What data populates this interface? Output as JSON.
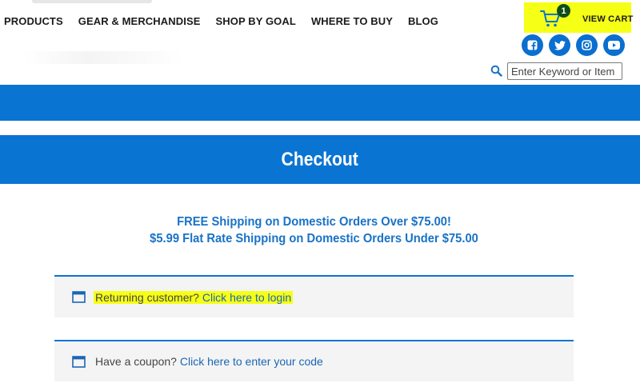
{
  "nav": {
    "items": [
      {
        "label": "PRODUCTS"
      },
      {
        "label": "GEAR & MERCHANDISE"
      },
      {
        "label": "SHOP BY GOAL"
      },
      {
        "label": "WHERE TO BUY"
      },
      {
        "label": "BLOG"
      }
    ]
  },
  "cart": {
    "count": "1",
    "label": "VIEW CART",
    "highlight_color": "#f6ff16"
  },
  "social": [
    "facebook-icon",
    "twitter-icon",
    "instagram-icon",
    "youtube-icon"
  ],
  "search": {
    "placeholder": "Enter Keyword or Item"
  },
  "page": {
    "title": "Checkout",
    "band_color": "#0a74d2"
  },
  "shipping": {
    "line1": "FREE Shipping on Domestic Orders Over $75.00!",
    "line2": "$5.99 Flat Rate Shipping on Domestic Orders Under $75.00"
  },
  "notices": {
    "login": {
      "prefix": "Returning customer?",
      "link": "Click here to login"
    },
    "coupon": {
      "prefix": "Have a coupon?",
      "link": "Click here to enter your code"
    }
  }
}
